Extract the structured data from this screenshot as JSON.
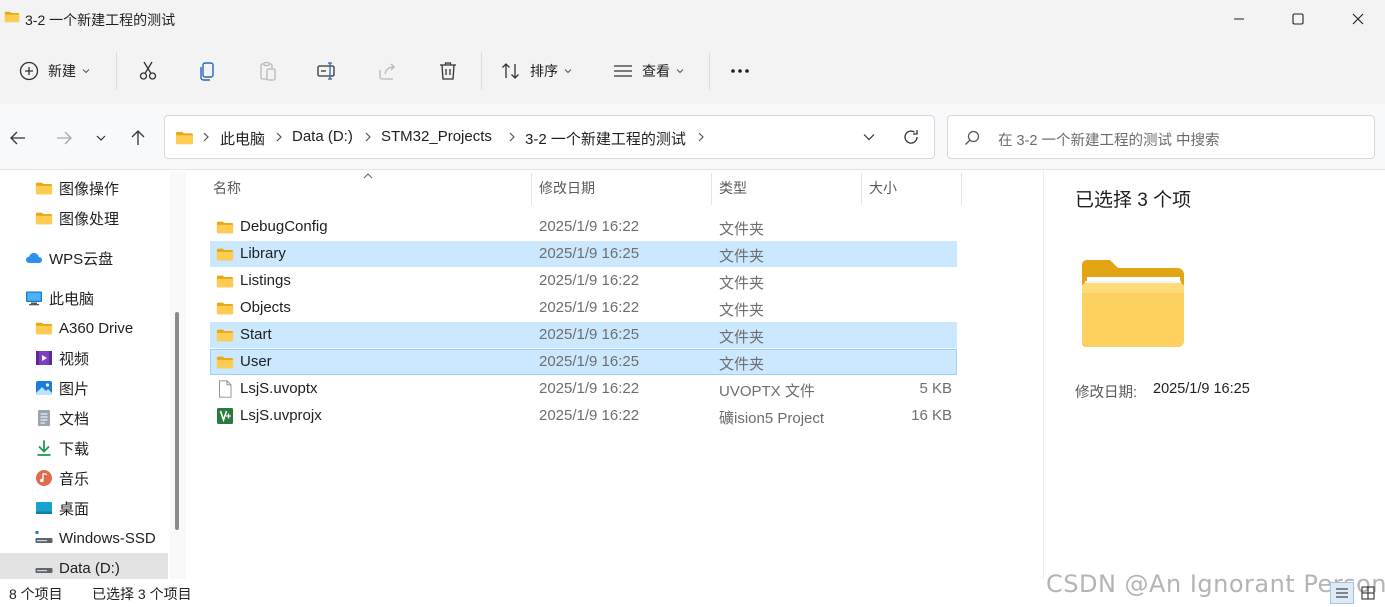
{
  "window": {
    "title": "3-2 一个新建工程的测试",
    "controls": [
      "minimize-icon",
      "maximize-icon",
      "close-icon"
    ]
  },
  "toolbar": {
    "new_label": "新建",
    "sort_label": "排序",
    "view_label": "查看",
    "icons": [
      "add-icon",
      "cut-icon",
      "copy-icon",
      "paste-icon",
      "rename-icon",
      "share-icon",
      "delete-icon",
      "sort-icon",
      "view-icon",
      "more-icon"
    ]
  },
  "navigation": {
    "breadcrumbs": [
      "此电脑",
      "Data (D:)",
      "STM32_Projects",
      "3-2 一个新建工程的测试"
    ],
    "search_placeholder": "在 3-2 一个新建工程的测试 中搜索"
  },
  "sidebar": {
    "items": [
      {
        "label": "图像操作",
        "icon": "folder-icon"
      },
      {
        "label": "图像处理",
        "icon": "folder-icon"
      },
      {
        "label": "WPS云盘",
        "icon": "cloud-icon"
      },
      {
        "label": "此电脑",
        "icon": "computer-icon"
      },
      {
        "label": "A360 Drive",
        "icon": "folder-icon"
      },
      {
        "label": "视频",
        "icon": "video-icon"
      },
      {
        "label": "图片",
        "icon": "picture-icon"
      },
      {
        "label": "文档",
        "icon": "document-icon"
      },
      {
        "label": "下载",
        "icon": "download-icon"
      },
      {
        "label": "音乐",
        "icon": "music-icon"
      },
      {
        "label": "桌面",
        "icon": "desktop-icon"
      },
      {
        "label": "Windows-SSD",
        "icon": "drive-icon"
      },
      {
        "label": "Data (D:)",
        "icon": "drive-icon"
      }
    ]
  },
  "filelist": {
    "columns": [
      "名称",
      "修改日期",
      "类型",
      "大小"
    ],
    "rows": [
      {
        "name": "DebugConfig",
        "date": "2025/1/9 16:22",
        "type": "文件夹",
        "size": "",
        "icon": "folder-icon",
        "selected": false
      },
      {
        "name": "Library",
        "date": "2025/1/9 16:25",
        "type": "文件夹",
        "size": "",
        "icon": "folder-icon",
        "selected": true
      },
      {
        "name": "Listings",
        "date": "2025/1/9 16:22",
        "type": "文件夹",
        "size": "",
        "icon": "folder-icon",
        "selected": false
      },
      {
        "name": "Objects",
        "date": "2025/1/9 16:22",
        "type": "文件夹",
        "size": "",
        "icon": "folder-icon",
        "selected": false
      },
      {
        "name": "Start",
        "date": "2025/1/9 16:25",
        "type": "文件夹",
        "size": "",
        "icon": "folder-icon",
        "selected": true
      },
      {
        "name": "User",
        "date": "2025/1/9 16:25",
        "type": "文件夹",
        "size": "",
        "icon": "folder-icon",
        "selected": true
      },
      {
        "name": "LsjS.uvoptx",
        "date": "2025/1/9 16:22",
        "type": "UVOPTX 文件",
        "size": "5 KB",
        "icon": "file-icon",
        "selected": false
      },
      {
        "name": "LsjS.uvprojx",
        "date": "2025/1/9 16:22",
        "type": "礦ision5 Project",
        "size": "16 KB",
        "icon": "keil-project-icon",
        "selected": false
      }
    ]
  },
  "details": {
    "title": "已选择 3 个项",
    "modified_label": "修改日期:",
    "modified_value": "2025/1/9 16:25"
  },
  "status": {
    "item_count": "8 个项目",
    "selected_count": "已选择 3 个项目"
  },
  "watermark": "CSDN @An Ignorant Person",
  "colors": {
    "selection": "#cce8ff",
    "selection_border": "#99d1ff",
    "folder": "#f8c63d",
    "chrome": "#f3f3f3"
  }
}
